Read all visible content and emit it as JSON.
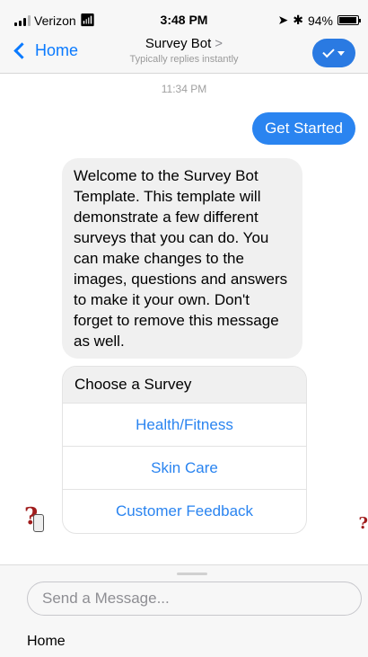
{
  "status_bar": {
    "carrier": "Verizon",
    "time": "3:48 PM",
    "battery": "94%",
    "battery_level": 0.94
  },
  "nav": {
    "back_label": "Home",
    "title": "Survey Bot",
    "title_chevron": ">",
    "subtitle": "Typically replies instantly"
  },
  "chat": {
    "timestamp": "11:34 PM",
    "user_message": "Get Started",
    "bot_message": "Welcome to the Survey Bot Template. This template will demonstrate a few different surveys that you can do. You can make changes to the images, questions and answers to make it your own. Don't forget to remove this message as well.",
    "card": {
      "title": "Choose a Survey",
      "buttons": [
        "Health/Fitness",
        "Skin Care",
        "Customer Feedback"
      ]
    }
  },
  "composer": {
    "placeholder": "Send a Message...",
    "menu_item": "Home"
  },
  "colors": {
    "accent": "#2a84f0",
    "link": "#0a7aff",
    "bubble_gray": "#f0f0f0",
    "avatar_red": "#a01c1c"
  }
}
